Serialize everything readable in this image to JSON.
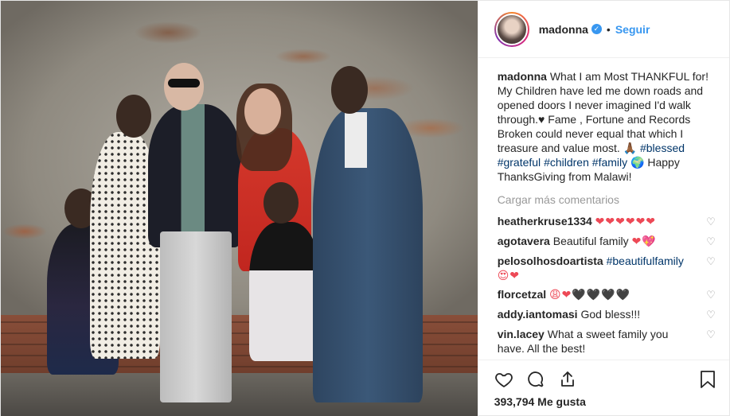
{
  "post": {
    "username": "madonna",
    "follow_label": "Seguir",
    "separator": "•",
    "caption_user": "madonna",
    "caption_text": "What I am Most THANKFUL for! My Children have led me down roads and opened doors I never imagined I'd walk through.♥ Fame , Fortune and Records Broken could never equal that which I treasure and value most. 🙏🏾",
    "caption_tags": [
      "#blessed",
      "#grateful",
      "#children",
      "#family"
    ],
    "caption_tail": "🌍 Happy ThanksGiving from Malawi!",
    "load_more": "Cargar más comentarios",
    "comments": [
      {
        "user": "heatherkruse1334",
        "text": "",
        "emoji": "❤❤❤❤❤❤"
      },
      {
        "user": "agotavera",
        "text": "Beautiful family",
        "emoji": "❤💖"
      },
      {
        "user": "pelosolhosdoartista",
        "text": "",
        "tag": "#beautifulfamily",
        "emoji": "😍❤"
      },
      {
        "user": "florcetzal",
        "text": "",
        "emoji": "😩❤🖤🖤🖤🖤"
      },
      {
        "user": "addy.iantomasi",
        "text": "God bless!!!",
        "emoji": ""
      },
      {
        "user": "vin.lacey",
        "text": "What a sweet family you have. All the best!",
        "emoji": ""
      }
    ],
    "likes": "393,794 Me gusta"
  },
  "icons": {
    "like": "heart-outline-icon",
    "comment": "comment-bubble-icon",
    "share": "share-icon",
    "save": "bookmark-icon",
    "verified": "verified-badge-icon"
  },
  "colors": {
    "link": "#3897f0",
    "hashtag": "#003569",
    "heart": "#ed4956",
    "muted": "#999999"
  }
}
